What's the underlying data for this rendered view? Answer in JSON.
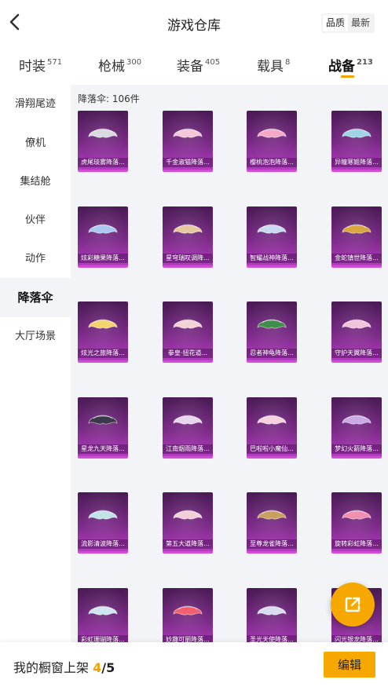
{
  "header": {
    "title": "游戏仓库",
    "sort_options": [
      "品质",
      "最新"
    ],
    "sort_active": 0
  },
  "tabs": [
    {
      "label": "时装",
      "count": "571"
    },
    {
      "label": "枪械",
      "count": "300"
    },
    {
      "label": "装备",
      "count": "405"
    },
    {
      "label": "载具",
      "count": "8"
    },
    {
      "label": "战备",
      "count": "213"
    }
  ],
  "tabs_active": 4,
  "sidebar": {
    "items": [
      "滑翔尾迹",
      "僚机",
      "集结舱",
      "伙伴",
      "动作",
      "降落伞",
      "大厅场景"
    ],
    "active": 5
  },
  "main": {
    "count_text": "降落伞: 106件",
    "items": [
      {
        "label": "虎尾琰雾降落...",
        "color": "#d9d9e0"
      },
      {
        "label": "千金淑猫降落...",
        "color": "#f2c8d8"
      },
      {
        "label": "樱桃泡泡降落...",
        "color": "#f3a9c6"
      },
      {
        "label": "异瞳寒姬降落...",
        "color": "#9fd3e6"
      },
      {
        "label": "炫彩糖果降落...",
        "color": "#a9c9f0"
      },
      {
        "label": "星穹瑞叹调降...",
        "color": "#e6c9a0"
      },
      {
        "label": "智耀战神降落...",
        "color": "#c9d9f2"
      },
      {
        "label": "金蛇镇世降落...",
        "color": "#d9a640"
      },
      {
        "label": "炫光之旅降落...",
        "color": "#f5d36b"
      },
      {
        "label": "拳皇·扭花道...",
        "color": "#f3d3d3"
      },
      {
        "label": "忍者神龟降落...",
        "color": "#3f8f4a"
      },
      {
        "label": "守护天翼降落...",
        "color": "#f2c4da"
      },
      {
        "label": "星龙九天降落...",
        "color": "#3a3a4a"
      },
      {
        "label": "江南烟雨降落...",
        "color": "#e8d6f0"
      },
      {
        "label": "巴啦啦小魔仙...",
        "color": "#f7d1de"
      },
      {
        "label": "梦幻火箭降落...",
        "color": "#c9a9e6"
      },
      {
        "label": "流影清波降落...",
        "color": "#bfe3e6"
      },
      {
        "label": "第五大道降落...",
        "color": "#f2cfd6"
      },
      {
        "label": "至尊龙雀降落...",
        "color": "#c9a060"
      },
      {
        "label": "旋转彩虹降落...",
        "color": "#f28fb0"
      },
      {
        "label": "彩虹珊瑚降落...",
        "color": "#cfe6f2"
      },
      {
        "label": "妙趣可丽降落...",
        "color": "#f06070"
      },
      {
        "label": "圣光天使降落...",
        "color": "#d9dcf0"
      },
      {
        "label": "闪光银龙降落...",
        "color": "#f3d6e6"
      }
    ]
  },
  "fab": {
    "icon": "share-icon"
  },
  "bottom": {
    "label": "我的橱窗上架 ",
    "current": "4",
    "total": "/5",
    "edit_label": "编辑"
  }
}
